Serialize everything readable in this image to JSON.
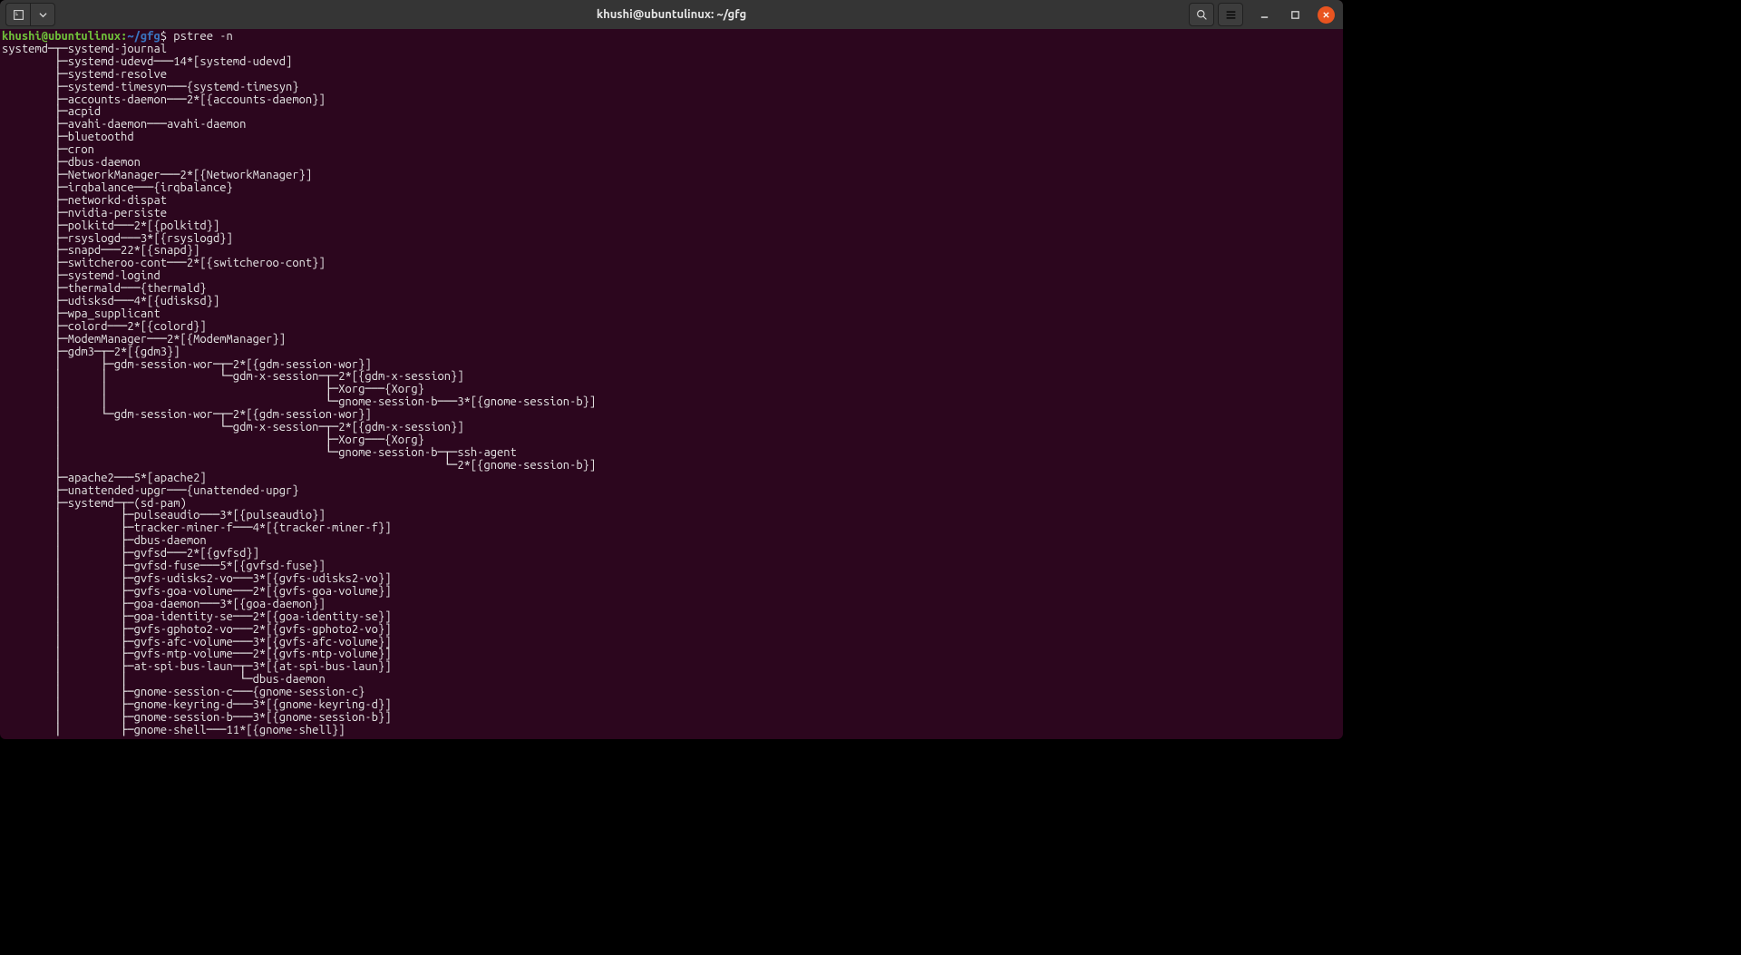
{
  "window": {
    "title": "khushi@ubuntulinux: ~/gfg"
  },
  "prompt": {
    "user_host": "khushi@ubuntulinux",
    "colon": ":",
    "path": "~/gfg",
    "dollar": "$",
    "command": "pstree -n"
  },
  "tree_lines": [
    "systemd─┬─systemd-journal",
    "        ├─systemd-udevd───14*[systemd-udevd]",
    "        ├─systemd-resolve",
    "        ├─systemd-timesyn───{systemd-timesyn}",
    "        ├─accounts-daemon───2*[{accounts-daemon}]",
    "        ├─acpid",
    "        ├─avahi-daemon───avahi-daemon",
    "        ├─bluetoothd",
    "        ├─cron",
    "        ├─dbus-daemon",
    "        ├─NetworkManager───2*[{NetworkManager}]",
    "        ├─irqbalance───{irqbalance}",
    "        ├─networkd-dispat",
    "        ├─nvidia-persiste",
    "        ├─polkitd───2*[{polkitd}]",
    "        ├─rsyslogd───3*[{rsyslogd}]",
    "        ├─snapd───22*[{snapd}]",
    "        ├─switcheroo-cont───2*[{switcheroo-cont}]",
    "        ├─systemd-logind",
    "        ├─thermald───{thermald}",
    "        ├─udisksd───4*[{udisksd}]",
    "        ├─wpa_supplicant",
    "        ├─colord───2*[{colord}]",
    "        ├─ModemManager───2*[{ModemManager}]",
    "        ├─gdm3─┬─2*[{gdm3}]",
    "        │      ├─gdm-session-wor─┬─2*[{gdm-session-wor}]",
    "        │      │                 └─gdm-x-session─┬─2*[{gdm-x-session}]",
    "        │      │                                 ├─Xorg───{Xorg}",
    "        │      │                                 └─gnome-session-b───3*[{gnome-session-b}]",
    "        │      └─gdm-session-wor─┬─2*[{gdm-session-wor}]",
    "        │                        └─gdm-x-session─┬─2*[{gdm-x-session}]",
    "        │                                        ├─Xorg───{Xorg}",
    "        │                                        └─gnome-session-b─┬─ssh-agent",
    "        │                                                          └─2*[{gnome-session-b}]",
    "        ├─apache2───5*[apache2]",
    "        ├─unattended-upgr───{unattended-upgr}",
    "        ├─systemd─┬─(sd-pam)",
    "        │         ├─pulseaudio───3*[{pulseaudio}]",
    "        │         ├─tracker-miner-f───4*[{tracker-miner-f}]",
    "        │         ├─dbus-daemon",
    "        │         ├─gvfsd───2*[{gvfsd}]",
    "        │         ├─gvfsd-fuse───5*[{gvfsd-fuse}]",
    "        │         ├─gvfs-udisks2-vo───3*[{gvfs-udisks2-vo}]",
    "        │         ├─gvfs-goa-volume───2*[{gvfs-goa-volume}]",
    "        │         ├─goa-daemon───3*[{goa-daemon}]",
    "        │         ├─goa-identity-se───2*[{goa-identity-se}]",
    "        │         ├─gvfs-gphoto2-vo───2*[{gvfs-gphoto2-vo}]",
    "        │         ├─gvfs-afc-volume───3*[{gvfs-afc-volume}]",
    "        │         ├─gvfs-mtp-volume───2*[{gvfs-mtp-volume}]",
    "        │         ├─at-spi-bus-laun─┬─3*[{at-spi-bus-laun}]",
    "        │         │                 └─dbus-daemon",
    "        │         ├─gnome-session-c───{gnome-session-c}",
    "        │         ├─gnome-keyring-d───3*[{gnome-keyring-d}]",
    "        │         ├─gnome-session-b───3*[{gnome-session-b}]",
    "        │         ├─gnome-shell───11*[{gnome-shell}]"
  ]
}
